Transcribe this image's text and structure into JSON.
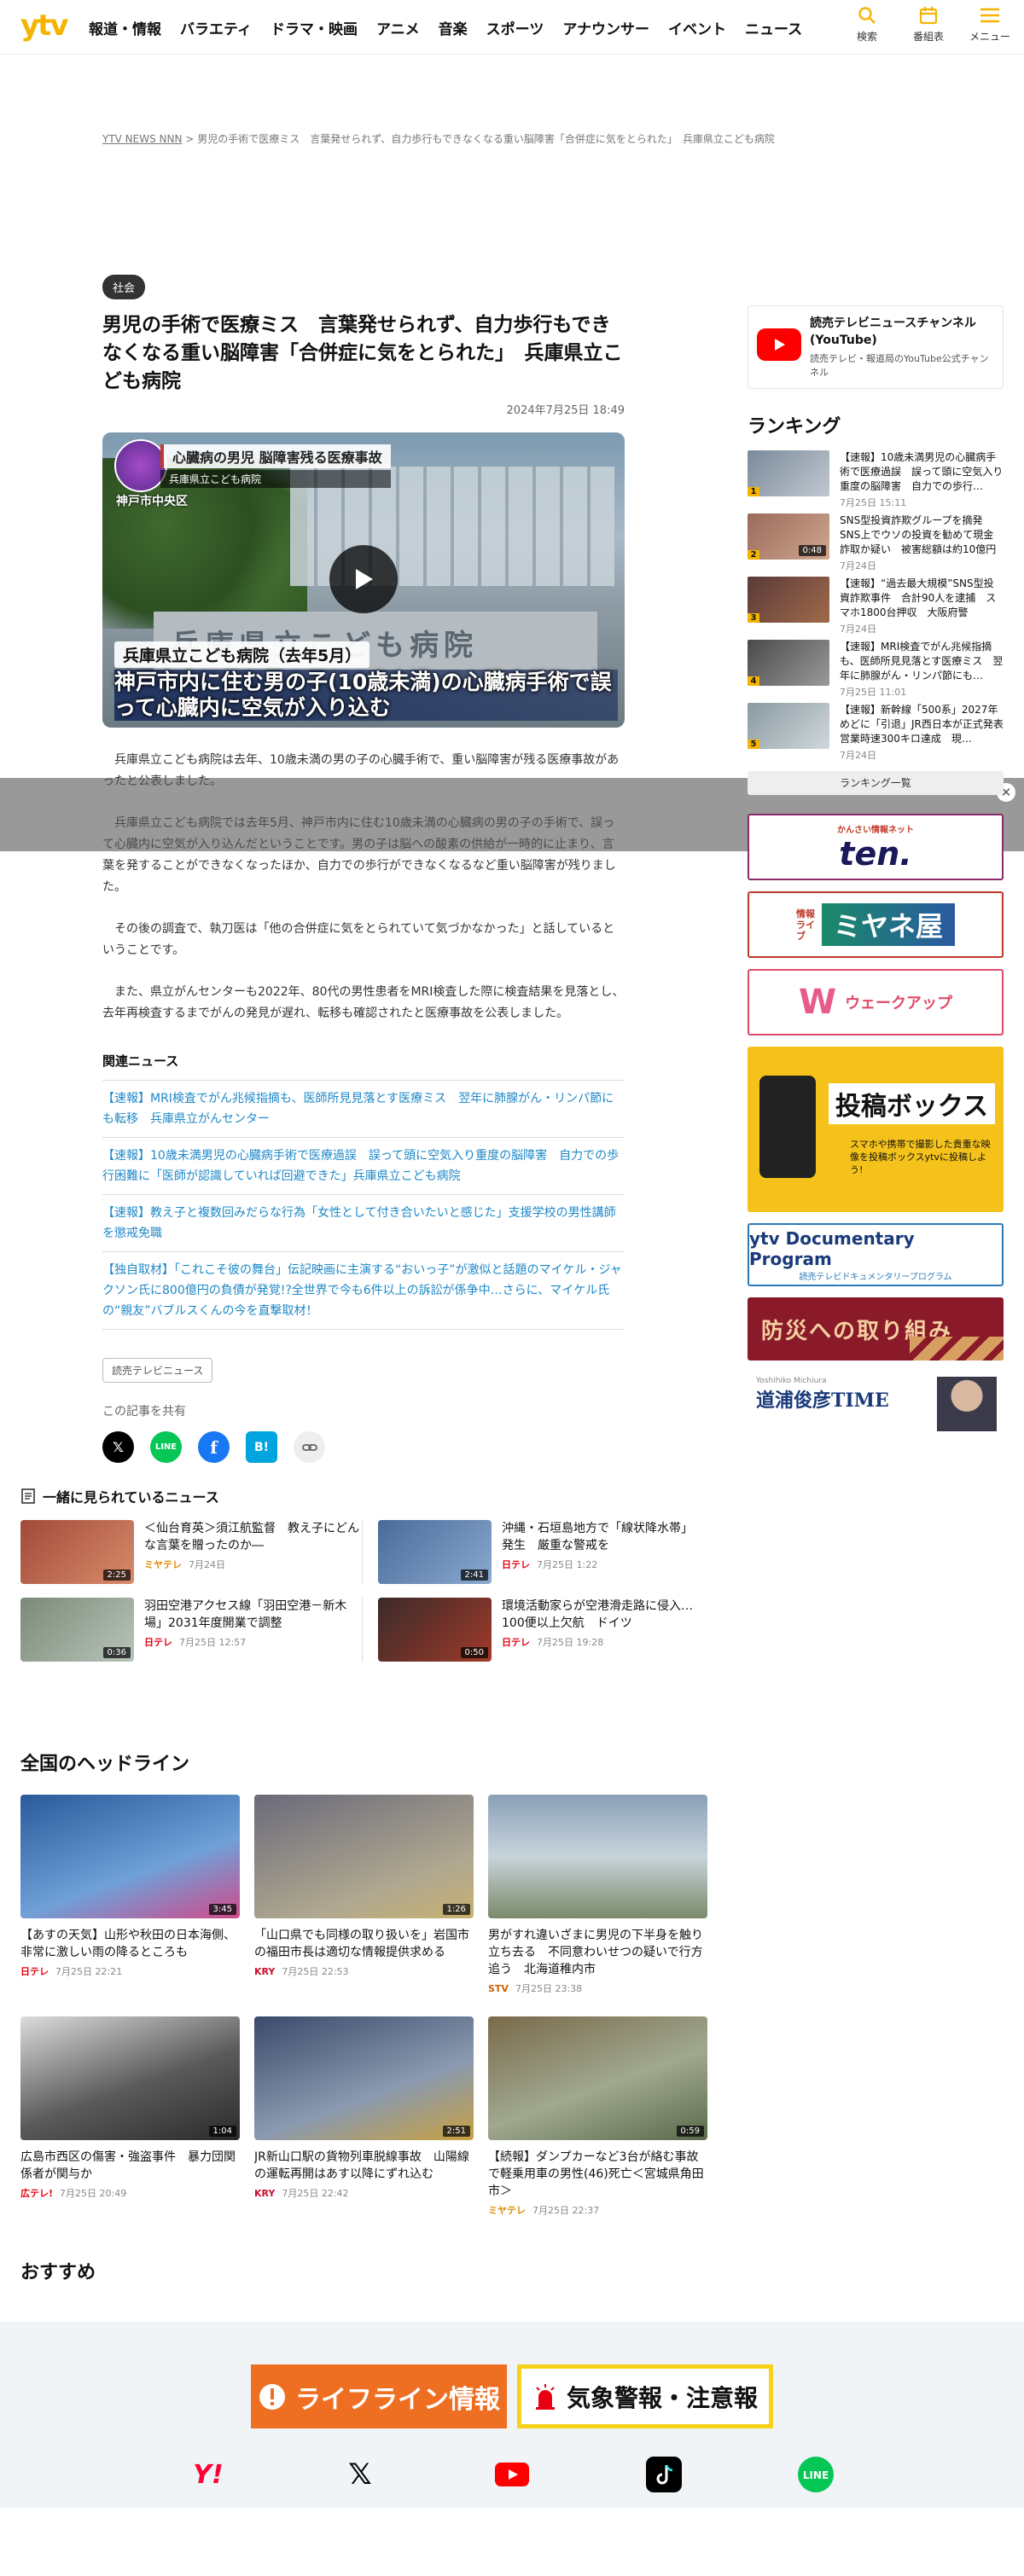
{
  "header": {
    "logo": "ytv",
    "nav": [
      "報道・情報",
      "バラエティ",
      "ドラマ・映画",
      "アニメ",
      "音楽",
      "スポーツ",
      "アナウンサー",
      "イベント",
      "ニュース"
    ],
    "icons": [
      {
        "label": "検索",
        "icon": "search-icon"
      },
      {
        "label": "番組表",
        "icon": "calendar-icon"
      },
      {
        "label": "メニュー",
        "icon": "menu-icon"
      }
    ]
  },
  "breadcrumb": {
    "home": "YTV NEWS NNN",
    "sep": ">",
    "current": "男児の手術で医療ミス　言葉発せられず、自力歩行もできなくなる重い脳障害「合併症に気をとられた」　兵庫県立こども病院"
  },
  "article": {
    "category": "社会",
    "title": "男児の手術で医療ミス　言葉発せられず、自力歩行もできなくなる重い脳障害「合併症に気をとられた」　兵庫県立こども病院",
    "date": "2024年7月25日 18:49",
    "telop": {
      "topic": "心臓病の男児 脳障害残る医療事故",
      "sub": "兵庫県立こども病院",
      "place": "神戸市中央区",
      "sign": "兵庫県立こども病院",
      "bottom_label": "兵庫県立こども病院（去年5月）",
      "bottom_main": "神戸市内に住む男の子(10歳未満)の心臓病手術で誤って心臓内に空気が入り込む"
    },
    "paragraphs": [
      "兵庫県立こども病院は去年、10歳未満の男の子の心臓手術で、重い脳障害が残る医療事故があったと公表しました。",
      "兵庫県立こども病院では去年5月、神戸市内に住む10歳未満の心臓病の男の子の手術で、誤って心臓内に空気が入り込んだということです。男の子は脳への酸素の供給が一時的に止まり、言葉を発することができなくなったほか、自力での歩行ができなくなるなど重い脳障害が残りました。",
      "その後の調査で、執刀医は「他の合併症に気をとられていて気づかなかった」と話しているということです。",
      "また、県立がんセンターも2022年、80代の男性患者をMRI検査した際に検査結果を見落とし、去年再検査するまでがんの発見が遅れ、転移も確認されたと医療事故を公表しました。"
    ]
  },
  "related": {
    "heading": "関連ニュース",
    "items": [
      "【速報】MRI検査でがん兆候指摘も、医師所見見落とす医療ミス　翌年に肺腺がん・リンパ節にも転移　兵庫県立がんセンター",
      "【速報】10歳未満男児の心臓病手術で医療過誤　誤って頭に空気入り重度の脳障害　自力での歩行困難に「医師が認識していれば回避できた」兵庫県立こども病院",
      "【速報】教え子と複数回みだらな行為「女性として付き合いたいと感じた」支援学校の男性講師を懲戒免職",
      "【独自取材】「これこそ彼の舞台」伝記映画に主演する“おいっ子”が激似と話題のマイケル・ジャクソン氏に800億円の負債が発覚!?全世界で今も6件以上の訴訟が係争中…さらに、マイケル氏の“親友”バブルスくんの今を直撃取材！"
    ]
  },
  "tag": "読売テレビニュース",
  "share": {
    "label": "この記事を共有",
    "buttons": [
      "X",
      "LINE",
      "Facebook",
      "B!",
      "リンク"
    ]
  },
  "also_watched": {
    "heading": "一緒に見られているニュース",
    "items": [
      {
        "title": "＜仙台育英＞須江航監督　教え子にどんな言葉を贈ったのか―",
        "source": "ミヤテレ",
        "date": "7月24日",
        "duration": "2:25",
        "color": "#a04a3a"
      },
      {
        "title": "沖縄・石垣島地方で「線状降水帯」発生　厳重な警戒を",
        "source": "日テレ",
        "date": "7月25日 1:22",
        "duration": "2:41",
        "color": "#4a6a9a"
      },
      {
        "title": "羽田空港アクセス線「羽田空港－新木場」2031年度開業で調整",
        "source": "日テレ",
        "date": "7月25日 12:57",
        "duration": "0:36",
        "color": "#7a8a7a"
      },
      {
        "title": "環境活動家らが空港滑走路に侵入…100便以上欠航　ドイツ",
        "source": "日テレ",
        "date": "7月25日 19:28",
        "duration": "0:50",
        "color": "#3a2a2a"
      }
    ]
  },
  "headlines": {
    "heading": "全国のヘッドライン",
    "items": [
      {
        "title": "【あすの天気】山形や秋田の日本海側、非常に激しい雨の降るところも",
        "source": "日テレ",
        "date": "7月25日 22:21",
        "duration": "3:45",
        "color": "#2a5a9a"
      },
      {
        "title": "「山口県でも同様の取り扱いを」岩国市の福田市長は適切な情報提供求める",
        "source": "KRY",
        "date": "7月25日 22:53",
        "duration": "1:26",
        "color": "#6a6a7a"
      },
      {
        "title": "男がすれ違いざまに男児の下半身を触り立ち去る　不同意わいせつの疑いで行方追う　北海道稚内市",
        "source": "STV",
        "date": "7月25日 23:38",
        "duration": "",
        "color": "#8aa0b8"
      },
      {
        "title": "広島市西区の傷害・強盗事件　暴力団関係者が関与か",
        "source": "広テレ!",
        "date": "7月25日 20:49",
        "duration": "1:04",
        "color": "#5a5a5a"
      },
      {
        "title": "JR新山口駅の貨物列車脱線事故　山陽線の運転再開はあす以降にずれ込む",
        "source": "KRY",
        "date": "7月25日 22:42",
        "duration": "2:51",
        "color": "#3a4a6a"
      },
      {
        "title": "【続報】ダンプカーなど3台が絡む事故で軽乗用車の男性(46)死亡＜宮城県角田市＞",
        "source": "ミヤテレ",
        "date": "7月25日 22:37",
        "duration": "0:59",
        "color": "#7a6a4a"
      }
    ]
  },
  "osusume": {
    "heading": "おすすめ"
  },
  "footer": {
    "lifeline": "ライフライン情報",
    "warning": "気象警報・注意報",
    "social": [
      "Y!",
      "X",
      "YouTube",
      "TikTok",
      "LINE"
    ]
  },
  "sidebar": {
    "youtube": {
      "name": "読売テレビニュースチャンネル(YouTube)",
      "desc": "読売テレビ・報道局のYouTube公式チャンネル"
    },
    "ranking": {
      "heading": "ランキング",
      "items": [
        {
          "rank": "1",
          "title": "【速報】10歳未満男児の心臓病手術で医療過誤　誤って頭に空気入り重度の脳障害　自力での歩行…",
          "date": "7月25日 15:11",
          "duration": "",
          "color": "#7a8a9a"
        },
        {
          "rank": "2",
          "title": "SNS型投資詐欺グループを摘発　SNS上でウソの投資を勧めて現金詐取か疑い　被害総額は約10億円",
          "date": "7月24日",
          "duration": "0:48",
          "color": "#9a6a5a"
        },
        {
          "rank": "3",
          "title": "【速報】“過去最大規模”SNS型投資詐欺事件　合計90人を逮捕　スマホ1800台押収　大阪府警",
          "date": "7月24日",
          "duration": "",
          "color": "#5a3a3a"
        },
        {
          "rank": "4",
          "title": "【速報】MRI検査でがん兆候指摘も、医師所見見落とす医療ミス　翌年に肺腺がん・リンパ節にも…",
          "date": "7月25日 11:01",
          "duration": "",
          "color": "#4a4a4a"
        },
        {
          "rank": "5",
          "title": "【速報】新幹線「500系」2027年めどに「引退」JR西日本が正式発表　営業時速300キロ達成　現…",
          "date": "7月24日",
          "duration": "",
          "color": "#8a9aa0"
        }
      ],
      "more": "ランキング一覧"
    },
    "banners": [
      {
        "label": "ten.",
        "sub": "かんさい情報ネット"
      },
      {
        "label": "ミヤネ屋",
        "sub": "情報ライブ"
      },
      {
        "label": "ウェークアップ",
        "sub": ""
      },
      {
        "label": "投稿ボックス",
        "sub": "スマホや携帯で撮影した貴重な映像を投稿ボックスytvに投稿しよう!"
      },
      {
        "label": "ytv Documentary Program",
        "sub": "読売テレビドキュメンタリープログラム"
      },
      {
        "label": "防災への取り組み",
        "sub": ""
      },
      {
        "label": "道浦俊彦TIME",
        "sub": "Yoshihiko Michiura"
      }
    ]
  }
}
